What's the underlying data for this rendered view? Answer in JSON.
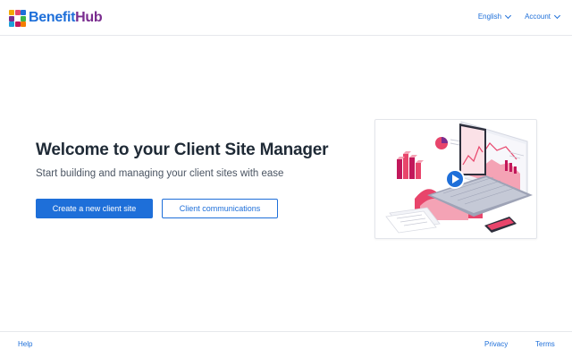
{
  "header": {
    "logo_text_1": "Benefit",
    "logo_text_2": "Hub",
    "language_label": "English",
    "account_label": "Account"
  },
  "hero": {
    "title": "Welcome to your Client Site Manager",
    "subtitle": "Start building and managing your client sites with ease",
    "primary_button": "Create a new client site",
    "secondary_button": "Client communications"
  },
  "illustration": {
    "icon": "laptop-analytics-illustration",
    "play_icon": "play-icon"
  },
  "footer": {
    "help": "Help",
    "privacy": "Privacy",
    "terms": "Terms"
  },
  "colors": {
    "accent": "#1e6fd9",
    "brand_purple": "#7a2d8f",
    "illustration_pink": "#e8456b",
    "illustration_magenta": "#c2185b"
  }
}
